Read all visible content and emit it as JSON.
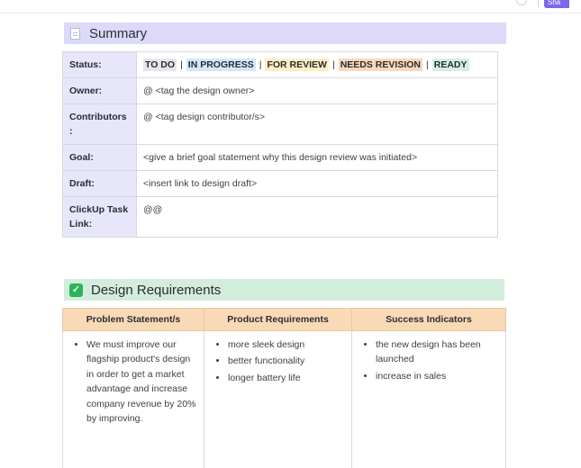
{
  "toolbar": {
    "button_label": "Sha"
  },
  "summary": {
    "heading": "Summary",
    "status_label": "Status:",
    "statuses": [
      "TO DO",
      "IN PROGRESS",
      "FOR REVIEW",
      "NEEDS REVISION",
      "READY"
    ],
    "separator": "|",
    "owner_label": "Owner:",
    "owner_value": "@ <tag the design owner>",
    "contributors_label": "Contributors :",
    "contributors_value": "@ <tag design contributor/s>",
    "goal_label": "Goal:",
    "goal_value": "<give a brief goal statement why this design review was initiated>",
    "draft_label": "Draft:",
    "draft_value": "<insert link to design draft>",
    "task_label": "ClickUp Task Link:",
    "task_value": "@@"
  },
  "design": {
    "heading": "Design Requirements",
    "columns": [
      "Problem Statement/s",
      "Product Requirements",
      "Success Indicators"
    ],
    "problems": [
      "We must improve our flagship product's design in order to get a market advantage and increase company revenue by 20% by improving."
    ],
    "requirements": [
      "more sleek design",
      "better functionality",
      "longer battery life"
    ],
    "indicators": [
      "the new design has been launched",
      "increase in sales"
    ]
  },
  "colors": {
    "summary_banner": "#dcdaf8",
    "design_banner": "#d3eddd",
    "label_cell": "#e7e6fb",
    "header_cell": "#fad9b7",
    "check": "#2cb35b"
  }
}
